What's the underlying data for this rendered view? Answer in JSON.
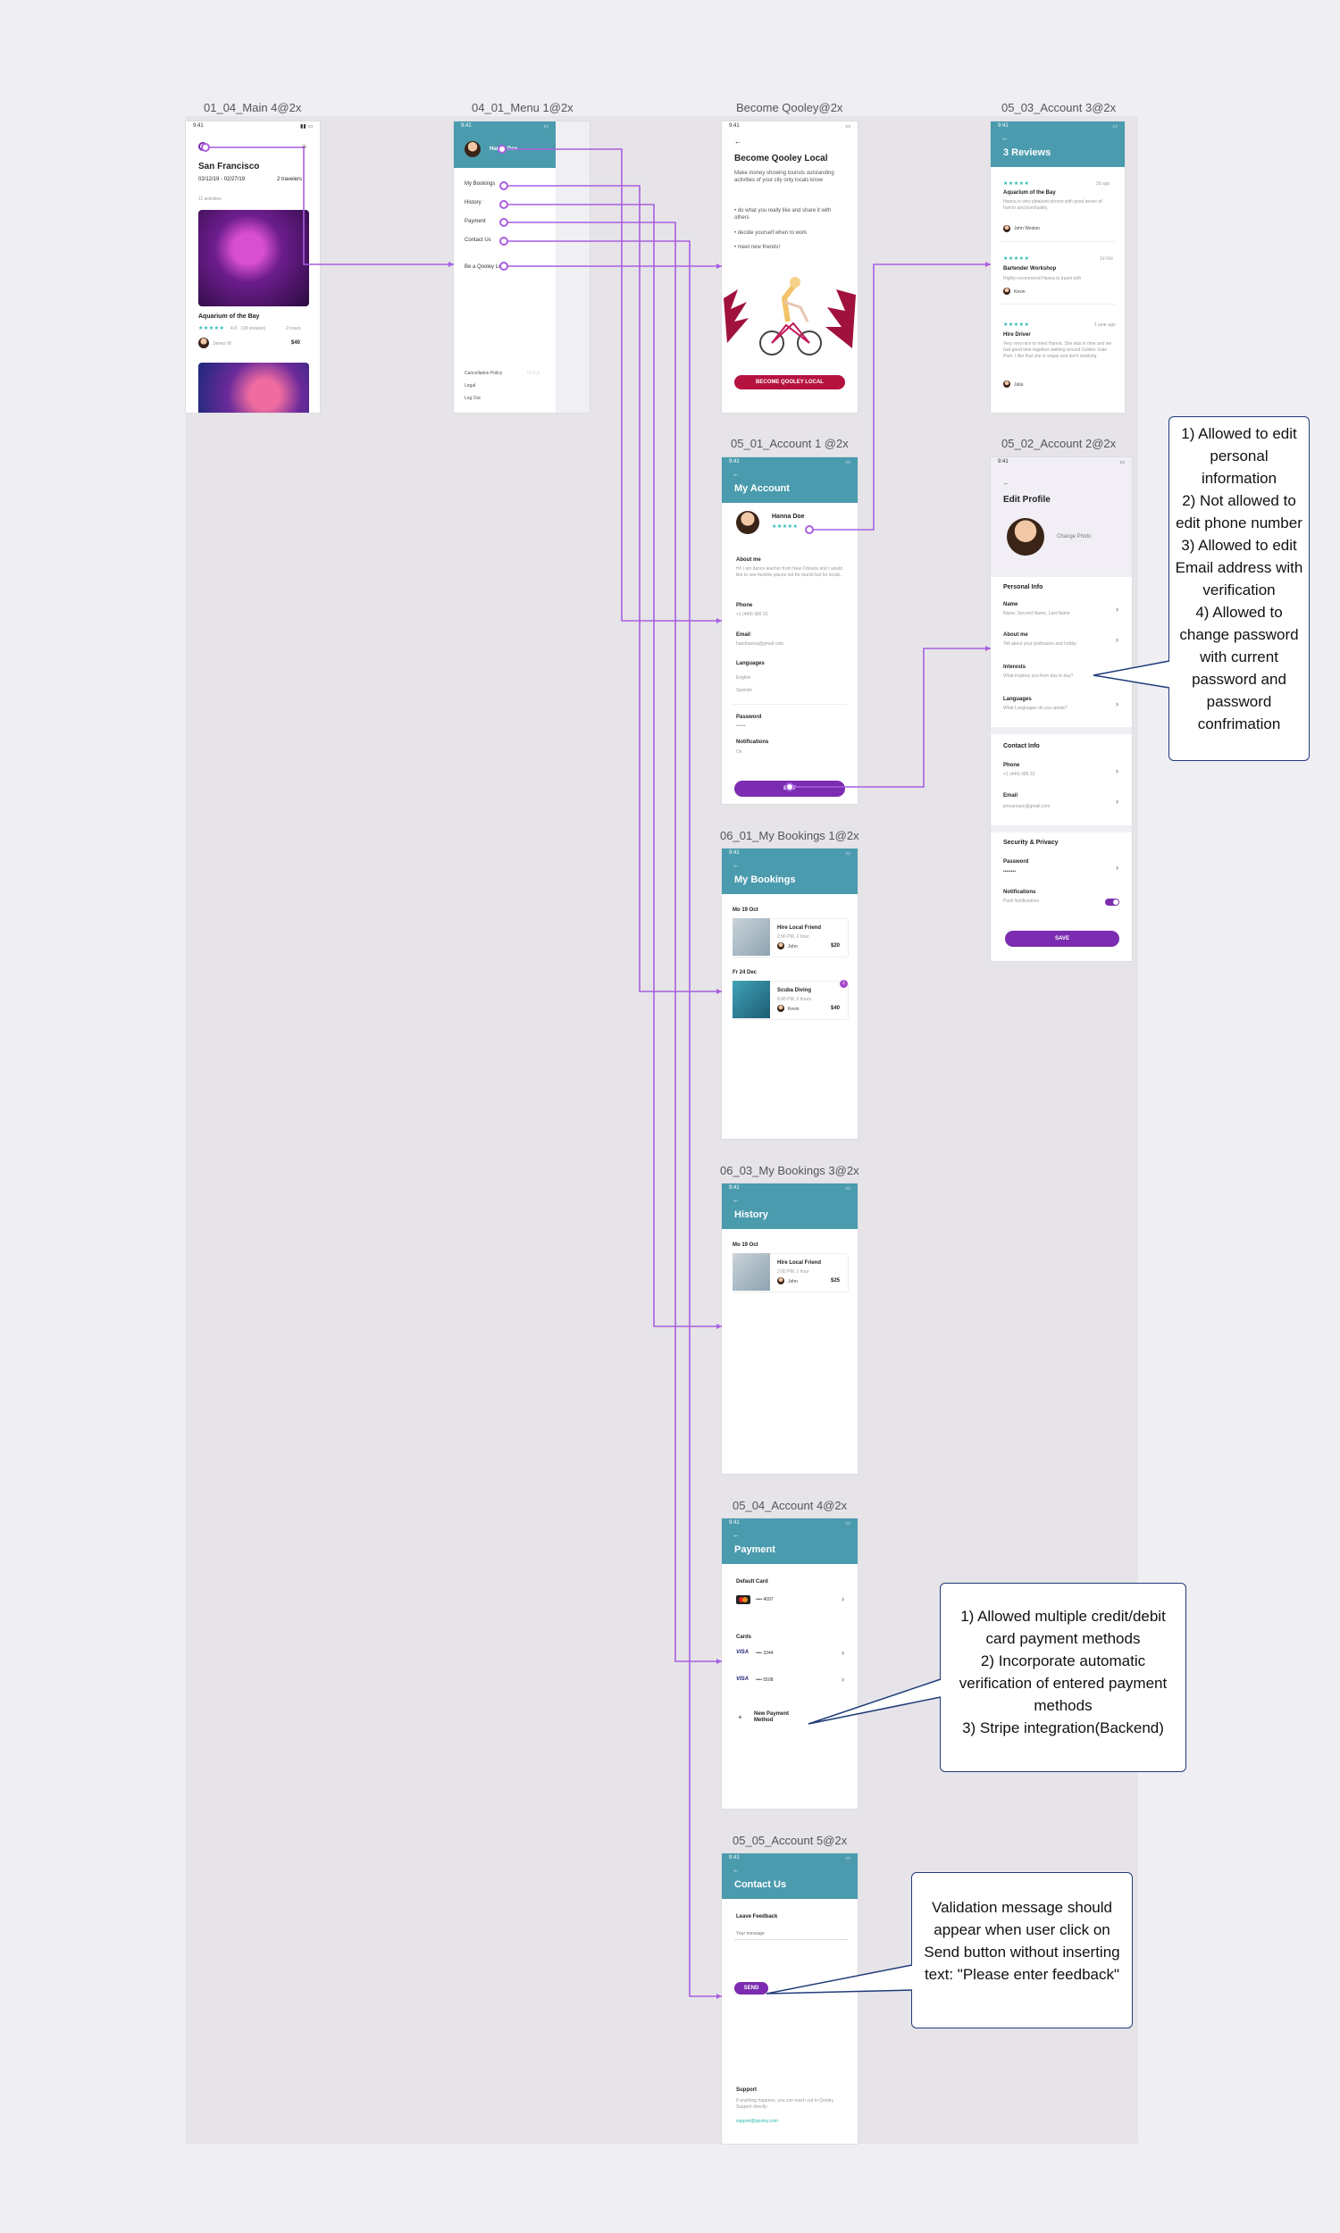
{
  "frames": {
    "main": {
      "label": "01_04_Main 4@2x",
      "status_time": "9:41",
      "city": "San Francisco",
      "dates": "02/12/19 - 02/27/19",
      "travelers": "2 travelers",
      "results": "11 activities",
      "card_title": "Aquarium of the Bay",
      "rating": "4.8",
      "reviews": "(18 reviews)",
      "duration": "2 hours",
      "host": "James W.",
      "price": "$40"
    },
    "menu": {
      "label": "04_01_Menu 1@2x",
      "status_time": "9:41",
      "user_name": "Hanna Doe",
      "items": [
        "My Bookings",
        "History",
        "Payment",
        "Contact Us",
        "Be a Qooley Local"
      ],
      "bottom_items": [
        "Cancellation Policy",
        "Legal",
        "Log Out"
      ],
      "version": "v1.0.0"
    },
    "become": {
      "label": "Become Qooley@2x",
      "status_time": "9:41",
      "back": "←",
      "title": "Become Qooley Local",
      "intro": "Make money showing tourists outstanding activities of your city only locals know",
      "bullets": [
        "do what you really like and share it with others",
        "decide yourself when to work",
        "meet new friends!"
      ],
      "cta": "BECOME QOOLEY LOCAL"
    },
    "reviews": {
      "label": "05_03_Account 3@2x",
      "status_time": "9:41",
      "back": "←",
      "title": "3 Reviews",
      "items": [
        {
          "stars": "★★★★★",
          "ago": "2d ago",
          "title": "Aquarium of the Bay",
          "text": "Hanna is very pleasant person with good sense of humor and punctuality.",
          "author": "John Weston"
        },
        {
          "stars": "★★★★★",
          "ago": "1d Oct",
          "title": "Bartender Workshop",
          "text": "Highly recommend Hanna to travel with",
          "author": "Kevin"
        },
        {
          "stars": "★★★★★",
          "ago": "1 year ago",
          "title": "Hire Driver",
          "text": "Very very nice to meet Hanna. She was in time and we had good time together walking around Golden Gate Park. I like that she is vegan and don't smoking",
          "author": "Julia"
        }
      ]
    },
    "account1": {
      "label": "05_01_Account 1 @2x",
      "status_time": "9:41",
      "back": "←",
      "title": "My Account",
      "name": "Hanna Doe",
      "stars": "★★★★★",
      "about_label": "About me",
      "about_text": "Hi! I am dance teacher from New Orleans and I would like to see favorite places not for tourist but for locals.",
      "phone_label": "Phone",
      "phone": "+1 (444) 386 33",
      "email_label": "Email",
      "email": "hannhanna@gmail.com",
      "lang_label": "Languages",
      "langs": [
        "English",
        "Spanish"
      ],
      "password_label": "Password",
      "password": "••••••",
      "notif_label": "Notifications",
      "notif": "On",
      "edit": "EDIT"
    },
    "account2": {
      "label": "05_02_Account 2@2x",
      "status_time": "9:41",
      "back": "←",
      "title": "Edit Profile",
      "change_photo": "Change Photo",
      "personal_info": "Personal Info",
      "fields": [
        {
          "label": "Name",
          "value": "Name, Second Name, Last Name"
        },
        {
          "label": "About me",
          "value": "Tell about your profession and hobby"
        },
        {
          "label": "Interests",
          "value": "What inspires you from day to day?"
        },
        {
          "label": "Languages",
          "value": "What Languages do you speak?"
        }
      ],
      "contact_info": "Contact Info",
      "contact_fields": [
        {
          "label": "Phone",
          "value": "+1 (444) 386 33"
        },
        {
          "label": "Email",
          "value": "jennamasn@gmail.com"
        }
      ],
      "security": "Security & Privacy",
      "password_label": "Password",
      "password": "••••••••",
      "notif_label": "Notifications",
      "notif_value": "Push Notifications",
      "save": "SAVE"
    },
    "bookings": {
      "label": "06_01_My Bookings 1@2x",
      "status_time": "9:41",
      "back": "←",
      "title": "My Bookings",
      "groups": [
        {
          "date": "Mo 19 Oct",
          "title": "Hire Local Friend",
          "time": "2:00 PM, 2 hour",
          "host": "John",
          "price": "$20"
        },
        {
          "date": "Fr 24 Dec",
          "title": "Scuba Diving",
          "time": "8:00 PM, 2 hours",
          "host": "Kevin",
          "price": "$40"
        }
      ],
      "badge": "1"
    },
    "history": {
      "label": "06_03_My Bookings 3@2x",
      "status_time": "9:41",
      "back": "←",
      "title": "History",
      "date": "Mo 19 Oct",
      "item_title": "Hire Local Friend",
      "item_time": "2:00 PM, 1 hour",
      "host": "John",
      "price": "$25"
    },
    "payment": {
      "label": "05_04_Account 4@2x",
      "status_time": "9:41",
      "back": "←",
      "title": "Payment",
      "default_card": "Default Card",
      "default_number": "•••• 4097",
      "cards_label": "Cards",
      "cards": [
        {
          "brand": "VISA",
          "number": "•••• 3344"
        },
        {
          "brand": "VISA",
          "number": "•••• 5508"
        }
      ],
      "new_method": "New Payment Method",
      "plus": "+"
    },
    "contact": {
      "label": "05_05_Account 5@2x",
      "status_time": "9:41",
      "back": "←",
      "title": "Contact Us",
      "leave_feedback": "Leave Feedback",
      "placeholder": "Your message",
      "send": "SEND",
      "support_title": "Support",
      "support_text": "If anything happens, you can reach out to Qooley Support directly",
      "support_email": "support@qooley.com"
    }
  },
  "notes": {
    "profile": "1) Allowed to edit personal information\n2) Not allowed to edit phone number\n3) Allowed to edit Email address with verification\n4) Allowed to change password with current password and password confrimation",
    "payment": "1) Allowed multiple credit/debit card payment methods\n2) Incorporate automatic verification of entered payment methods\n3) Stripe integration(Backend)",
    "contact": "Validation message should appear when user click on Send button without inserting text: \"Please enter feedback\""
  },
  "colors": {
    "teal_header": "#4a9bad",
    "purple": "#7b2cb0",
    "wire": "#a95fe0",
    "crimson": "#b5123f",
    "note_border": "#1f3b7a"
  }
}
